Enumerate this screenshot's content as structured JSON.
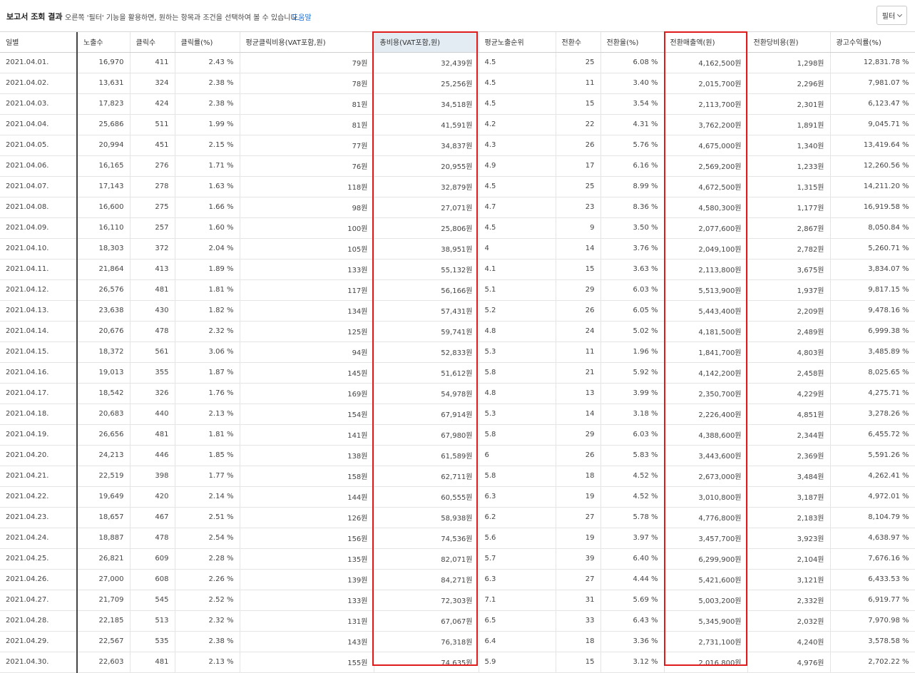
{
  "header": {
    "title": "보고서 조회 결과",
    "description": "오른쪽 '필터' 기능을 활용하면, 원하는 항목과 조건을 선택하여 볼 수 있습니다.",
    "help_link": "도움말",
    "filter_button": "필터",
    "filter_icon": "chevron-down-icon"
  },
  "table": {
    "columns": [
      "일별",
      "노출수",
      "클릭수",
      "클릭률(%)",
      "평균클릭비용(VAT포함,원)",
      "총비용(VAT포함,원)",
      "평균노출순위",
      "전환수",
      "전환율(%)",
      "전환매출액(원)",
      "전환당비용(원)",
      "광고수익률(%)"
    ],
    "sorted_column": "총비용(VAT포함,원)",
    "highlight_color": "#e01b1b",
    "rows": [
      [
        "2021.04.01.",
        "16,970",
        "411",
        "2.43 %",
        "79원",
        "32,439원",
        "4.5",
        "25",
        "6.08 %",
        "4,162,500원",
        "1,298원",
        "12,831.78 %"
      ],
      [
        "2021.04.02.",
        "13,631",
        "324",
        "2.38 %",
        "78원",
        "25,256원",
        "4.5",
        "11",
        "3.40 %",
        "2,015,700원",
        "2,296원",
        "7,981.07 %"
      ],
      [
        "2021.04.03.",
        "17,823",
        "424",
        "2.38 %",
        "81원",
        "34,518원",
        "4.5",
        "15",
        "3.54 %",
        "2,113,700원",
        "2,301원",
        "6,123.47 %"
      ],
      [
        "2021.04.04.",
        "25,686",
        "511",
        "1.99 %",
        "81원",
        "41,591원",
        "4.2",
        "22",
        "4.31 %",
        "3,762,200원",
        "1,891원",
        "9,045.71 %"
      ],
      [
        "2021.04.05.",
        "20,994",
        "451",
        "2.15 %",
        "77원",
        "34,837원",
        "4.3",
        "26",
        "5.76 %",
        "4,675,000원",
        "1,340원",
        "13,419.64 %"
      ],
      [
        "2021.04.06.",
        "16,165",
        "276",
        "1.71 %",
        "76원",
        "20,955원",
        "4.9",
        "17",
        "6.16 %",
        "2,569,200원",
        "1,233원",
        "12,260.56 %"
      ],
      [
        "2021.04.07.",
        "17,143",
        "278",
        "1.63 %",
        "118원",
        "32,879원",
        "4.5",
        "25",
        "8.99 %",
        "4,672,500원",
        "1,315원",
        "14,211.20 %"
      ],
      [
        "2021.04.08.",
        "16,600",
        "275",
        "1.66 %",
        "98원",
        "27,071원",
        "4.7",
        "23",
        "8.36 %",
        "4,580,300원",
        "1,177원",
        "16,919.58 %"
      ],
      [
        "2021.04.09.",
        "16,110",
        "257",
        "1.60 %",
        "100원",
        "25,806원",
        "4.5",
        "9",
        "3.50 %",
        "2,077,600원",
        "2,867원",
        "8,050.84 %"
      ],
      [
        "2021.04.10.",
        "18,303",
        "372",
        "2.04 %",
        "105원",
        "38,951원",
        "4",
        "14",
        "3.76 %",
        "2,049,100원",
        "2,782원",
        "5,260.71 %"
      ],
      [
        "2021.04.11.",
        "21,864",
        "413",
        "1.89 %",
        "133원",
        "55,132원",
        "4.1",
        "15",
        "3.63 %",
        "2,113,800원",
        "3,675원",
        "3,834.07 %"
      ],
      [
        "2021.04.12.",
        "26,576",
        "481",
        "1.81 %",
        "117원",
        "56,166원",
        "5.1",
        "29",
        "6.03 %",
        "5,513,900원",
        "1,937원",
        "9,817.15 %"
      ],
      [
        "2021.04.13.",
        "23,638",
        "430",
        "1.82 %",
        "134원",
        "57,431원",
        "5.2",
        "26",
        "6.05 %",
        "5,443,400원",
        "2,209원",
        "9,478.16 %"
      ],
      [
        "2021.04.14.",
        "20,676",
        "478",
        "2.32 %",
        "125원",
        "59,741원",
        "4.8",
        "24",
        "5.02 %",
        "4,181,500원",
        "2,489원",
        "6,999.38 %"
      ],
      [
        "2021.04.15.",
        "18,372",
        "561",
        "3.06 %",
        "94원",
        "52,833원",
        "5.3",
        "11",
        "1.96 %",
        "1,841,700원",
        "4,803원",
        "3,485.89 %"
      ],
      [
        "2021.04.16.",
        "19,013",
        "355",
        "1.87 %",
        "145원",
        "51,612원",
        "5.8",
        "21",
        "5.92 %",
        "4,142,200원",
        "2,458원",
        "8,025.65 %"
      ],
      [
        "2021.04.17.",
        "18,542",
        "326",
        "1.76 %",
        "169원",
        "54,978원",
        "4.8",
        "13",
        "3.99 %",
        "2,350,700원",
        "4,229원",
        "4,275.71 %"
      ],
      [
        "2021.04.18.",
        "20,683",
        "440",
        "2.13 %",
        "154원",
        "67,914원",
        "5.3",
        "14",
        "3.18 %",
        "2,226,400원",
        "4,851원",
        "3,278.26 %"
      ],
      [
        "2021.04.19.",
        "26,656",
        "481",
        "1.81 %",
        "141원",
        "67,980원",
        "5.8",
        "29",
        "6.03 %",
        "4,388,600원",
        "2,344원",
        "6,455.72 %"
      ],
      [
        "2021.04.20.",
        "24,213",
        "446",
        "1.85 %",
        "138원",
        "61,589원",
        "6",
        "26",
        "5.83 %",
        "3,443,600원",
        "2,369원",
        "5,591.26 %"
      ],
      [
        "2021.04.21.",
        "22,519",
        "398",
        "1.77 %",
        "158원",
        "62,711원",
        "5.8",
        "18",
        "4.52 %",
        "2,673,000원",
        "3,484원",
        "4,262.41 %"
      ],
      [
        "2021.04.22.",
        "19,649",
        "420",
        "2.14 %",
        "144원",
        "60,555원",
        "6.3",
        "19",
        "4.52 %",
        "3,010,800원",
        "3,187원",
        "4,972.01 %"
      ],
      [
        "2021.04.23.",
        "18,657",
        "467",
        "2.51 %",
        "126원",
        "58,938원",
        "6.2",
        "27",
        "5.78 %",
        "4,776,800원",
        "2,183원",
        "8,104.79 %"
      ],
      [
        "2021.04.24.",
        "18,887",
        "478",
        "2.54 %",
        "156원",
        "74,536원",
        "5.6",
        "19",
        "3.97 %",
        "3,457,700원",
        "3,923원",
        "4,638.97 %"
      ],
      [
        "2021.04.25.",
        "26,821",
        "609",
        "2.28 %",
        "135원",
        "82,071원",
        "5.7",
        "39",
        "6.40 %",
        "6,299,900원",
        "2,104원",
        "7,676.16 %"
      ],
      [
        "2021.04.26.",
        "27,000",
        "608",
        "2.26 %",
        "139원",
        "84,271원",
        "6.3",
        "27",
        "4.44 %",
        "5,421,600원",
        "3,121원",
        "6,433.53 %"
      ],
      [
        "2021.04.27.",
        "21,709",
        "545",
        "2.52 %",
        "133원",
        "72,303원",
        "7.1",
        "31",
        "5.69 %",
        "5,003,200원",
        "2,332원",
        "6,919.77 %"
      ],
      [
        "2021.04.28.",
        "22,185",
        "513",
        "2.32 %",
        "131원",
        "67,067원",
        "6.5",
        "33",
        "6.43 %",
        "5,345,900원",
        "2,032원",
        "7,970.98 %"
      ],
      [
        "2021.04.29.",
        "22,567",
        "535",
        "2.38 %",
        "143원",
        "76,318원",
        "6.4",
        "18",
        "3.36 %",
        "2,731,100원",
        "4,240원",
        "3,578.58 %"
      ],
      [
        "2021.04.30.",
        "22,603",
        "481",
        "2.13 %",
        "155원",
        "74,635원",
        "5.9",
        "15",
        "3.12 %",
        "2,016,800원",
        "4,976원",
        "2,702.22 %"
      ]
    ]
  }
}
